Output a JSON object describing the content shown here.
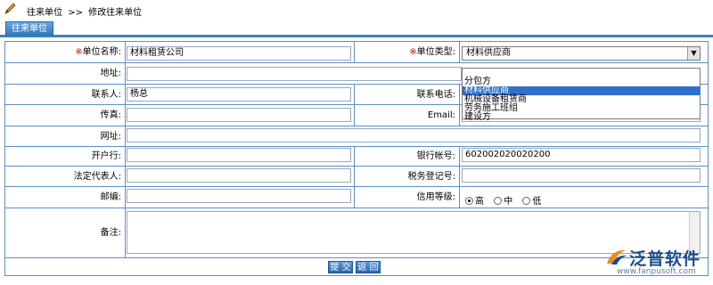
{
  "breadcrumb": {
    "items": [
      "往来单位",
      ">>",
      "修改往来单位"
    ]
  },
  "tab": {
    "label": "往来单位"
  },
  "fields": {
    "unit_name": {
      "required_mark": "※",
      "label": "单位名称:",
      "value": "材料租赁公司"
    },
    "unit_type": {
      "required_mark": "※",
      "label": "单位类型:",
      "value": "材料供应商"
    },
    "address": {
      "label": "地址:",
      "value": ""
    },
    "contact": {
      "label": "联系人:",
      "value": "杨总"
    },
    "phone": {
      "label": "联系电话:",
      "value": ""
    },
    "fax": {
      "label": "传真:",
      "value": ""
    },
    "email": {
      "label": "Email:",
      "value": ""
    },
    "website": {
      "label": "网址:",
      "value": ""
    },
    "bank": {
      "label": "开户行:",
      "value": ""
    },
    "account": {
      "label": "银行帐号:",
      "value": "602002020020200"
    },
    "legal_rep": {
      "label": "法定代表人:",
      "value": ""
    },
    "tax_reg": {
      "label": "税务登记号:",
      "value": ""
    },
    "postcode": {
      "label": "邮编:",
      "value": ""
    },
    "credit": {
      "label": "信用等级:",
      "options": [
        "高",
        "中",
        "低"
      ],
      "selected": "高"
    },
    "remark": {
      "label": "备注:",
      "value": ""
    }
  },
  "unit_type_options": [
    "",
    "分包方",
    "材料供应商",
    "机械设备租赁商",
    "劳务施工班组",
    "建设方"
  ],
  "unit_type_selected_index": 2,
  "buttons": {
    "submit": "提 交",
    "back": "返 回"
  },
  "logo": {
    "name": "泛普软件",
    "url": "www.fanpusoft.com"
  },
  "colors": {
    "border": "#5b8fc9",
    "accent": "#3f7fbf",
    "required": "#e00000",
    "selected_option": "#3070c8"
  }
}
